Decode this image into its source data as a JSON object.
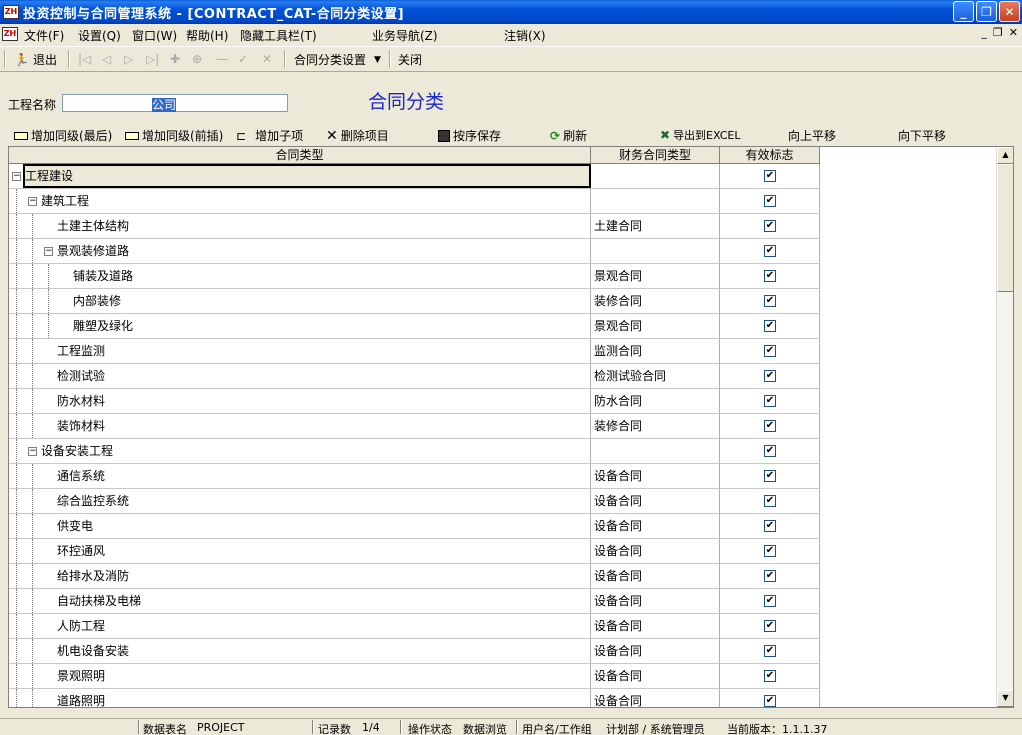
{
  "window": {
    "title": "投资控制与合同管理系统 - [CONTRACT_CAT-合同分类设置]"
  },
  "menubar": {
    "items": [
      "文件(F)",
      "设置(Q)",
      "窗口(W)",
      "帮助(H)",
      "隐藏工具栏(T)",
      "业务导航(Z)",
      "注销(X)"
    ]
  },
  "toolbar": {
    "exit_label": "退出",
    "dropdown_label": "合同分类设置",
    "close_label": "关闭"
  },
  "form": {
    "project_label": "工程名称",
    "project_value": "公司",
    "heading": "合同分类"
  },
  "actions": {
    "add_sibling_last": "增加同级(最后)",
    "add_sibling_before": "增加同级(前插)",
    "add_child": "增加子项",
    "delete": "删除项目",
    "save_order": "按序保存",
    "refresh": "刷新",
    "export_excel": "导出到EXCEL",
    "move_up": "向上平移",
    "move_down": "向下平移"
  },
  "grid": {
    "columns": [
      "合同类型",
      "财务合同类型",
      "有效标志"
    ],
    "rows": [
      {
        "name": "工程建设",
        "level": 0,
        "expand": true,
        "finance": "",
        "valid": true,
        "selected": true
      },
      {
        "name": "建筑工程",
        "level": 1,
        "expand": true,
        "finance": "",
        "valid": true
      },
      {
        "name": "土建主体结构",
        "level": 2,
        "expand": false,
        "finance": "土建合同",
        "valid": true
      },
      {
        "name": "景观装修道路",
        "level": 2,
        "expand": true,
        "finance": "",
        "valid": true
      },
      {
        "name": "铺装及道路",
        "level": 3,
        "expand": false,
        "finance": "景观合同",
        "valid": true
      },
      {
        "name": "内部装修",
        "level": 3,
        "expand": false,
        "finance": "装修合同",
        "valid": true
      },
      {
        "name": "雕塑及绿化",
        "level": 3,
        "expand": false,
        "finance": "景观合同",
        "valid": true
      },
      {
        "name": "工程监测",
        "level": 2,
        "expand": false,
        "finance": "监测合同",
        "valid": true
      },
      {
        "name": "检测试验",
        "level": 2,
        "expand": false,
        "finance": "检测试验合同",
        "valid": true
      },
      {
        "name": "防水材料",
        "level": 2,
        "expand": false,
        "finance": "防水合同",
        "valid": true
      },
      {
        "name": "装饰材料",
        "level": 2,
        "expand": false,
        "finance": "装修合同",
        "valid": true
      },
      {
        "name": "设备安装工程",
        "level": 1,
        "expand": true,
        "finance": "",
        "valid": true
      },
      {
        "name": "通信系统",
        "level": 2,
        "expand": false,
        "finance": "设备合同",
        "valid": true
      },
      {
        "name": "综合监控系统",
        "level": 2,
        "expand": false,
        "finance": "设备合同",
        "valid": true
      },
      {
        "name": "供变电",
        "level": 2,
        "expand": false,
        "finance": "设备合同",
        "valid": true
      },
      {
        "name": "环控通风",
        "level": 2,
        "expand": false,
        "finance": "设备合同",
        "valid": true
      },
      {
        "name": "给排水及消防",
        "level": 2,
        "expand": false,
        "finance": "设备合同",
        "valid": true
      },
      {
        "name": "自动扶梯及电梯",
        "level": 2,
        "expand": false,
        "finance": "设备合同",
        "valid": true
      },
      {
        "name": "人防工程",
        "level": 2,
        "expand": false,
        "finance": "设备合同",
        "valid": true
      },
      {
        "name": "机电设备安装",
        "level": 2,
        "expand": false,
        "finance": "设备合同",
        "valid": true
      },
      {
        "name": "景观照明",
        "level": 2,
        "expand": false,
        "finance": "设备合同",
        "valid": true
      },
      {
        "name": "道路照明",
        "level": 2,
        "expand": false,
        "finance": "设备合同",
        "valid": true
      }
    ]
  },
  "status": {
    "table_label": "数据表名",
    "table_value": "PROJECT",
    "record_label": "记录数",
    "record_value": "1/4",
    "op_label": "操作状态",
    "op_value": "数据浏览",
    "user_label": "用户名/工作组",
    "user_value": "计划部 / 系统管理员",
    "version": "当前版本：1.1.1.37"
  },
  "colors": {
    "title_bar": "#0052d6",
    "heading": "#1a28c8",
    "selection": "#316ac5"
  }
}
